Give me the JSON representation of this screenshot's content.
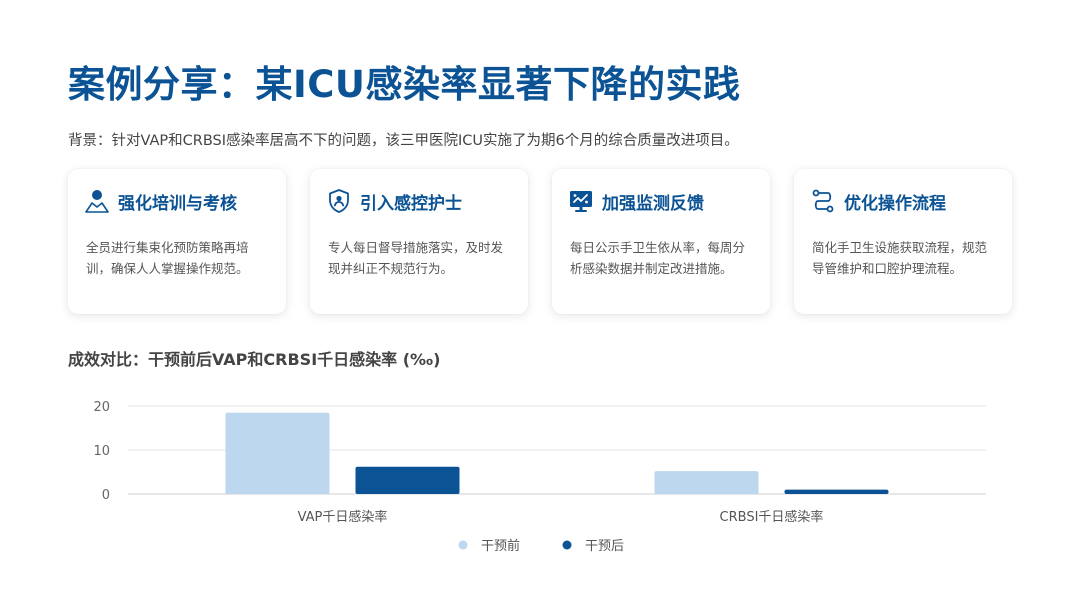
{
  "header": {
    "title": "案例分享：某ICU感染率显著下降的实践",
    "subtitle": "背景：针对VAP和CRBSI感染率居高不下的问题，该三甲医院ICU实施了为期6个月的综合质量改进项目。"
  },
  "cards": [
    {
      "icon": "trainer-icon",
      "title": "强化培训与考核",
      "body": "全员进行集束化预防策略再培训，确保人人掌握操作规范。"
    },
    {
      "icon": "shield-user-icon",
      "title": "引入感控护士",
      "body": "专人每日督导措施落实，及时发现并纠正不规范行为。"
    },
    {
      "icon": "monitor-chart-icon",
      "title": "加强监测反馈",
      "body": "每日公示手卫生依从率，每周分析感染数据并制定改进措施。"
    },
    {
      "icon": "workflow-icon",
      "title": "优化操作流程",
      "body": "简化手卫生设施获取流程，规范导管维护和口腔护理流程。"
    }
  ],
  "chart_section": {
    "title": "成效对比：干预前后VAP和CRBSI千日感染率 (‰)"
  },
  "colors": {
    "accent": "#0b5394",
    "before": "#bdd7ee",
    "after": "#0b5394"
  },
  "chart_data": {
    "type": "bar",
    "categories": [
      "VAP千日感染率",
      "CRBSI千日感染率"
    ],
    "series": [
      {
        "name": "干预前",
        "values": [
          18.5,
          5.2
        ]
      },
      {
        "name": "干预后",
        "values": [
          6.2,
          1.0
        ]
      }
    ],
    "yticks": [
      "0",
      "10",
      "20"
    ],
    "ylim": [
      0,
      20
    ],
    "grid": true,
    "legend": "bottom-center"
  }
}
